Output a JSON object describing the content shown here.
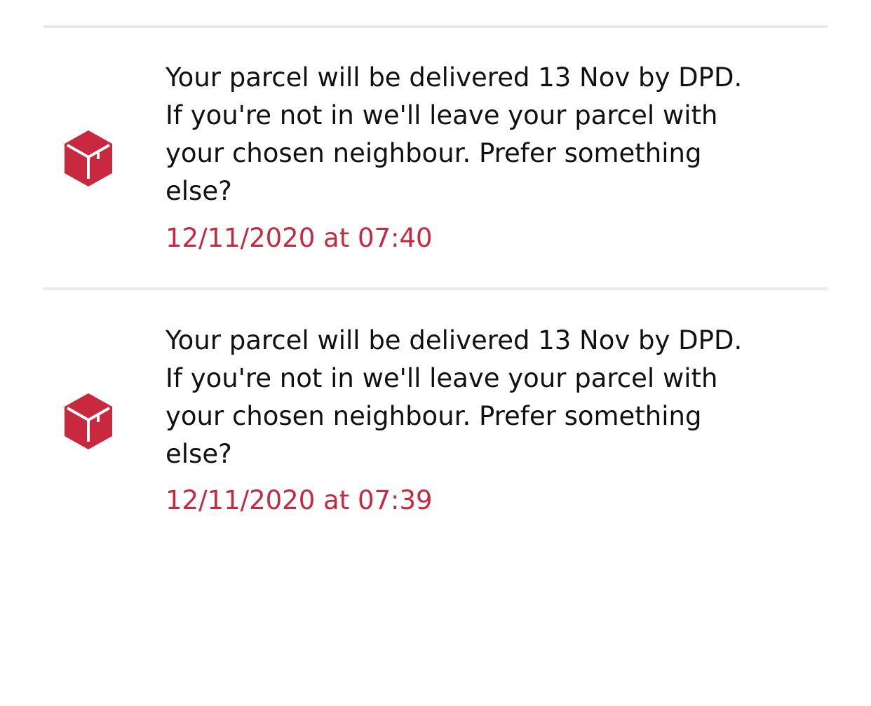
{
  "colors": {
    "accent": "#c8293f",
    "text": "#111111",
    "divider": "#e9e9e9",
    "background": "#ffffff"
  },
  "notifications": [
    {
      "icon": "parcel-box-icon",
      "message": "Your parcel will be delivered 13 Nov by DPD.\nIf you're not in we'll leave your parcel with\nyour chosen neighbour. Prefer something\nelse?",
      "timestamp": "12/11/2020 at 07:40"
    },
    {
      "icon": "parcel-box-icon",
      "message": "Your parcel will be delivered 13 Nov by DPD.\nIf you're not in we'll leave your parcel with\nyour chosen neighbour. Prefer something\nelse?",
      "timestamp": "12/11/2020 at 07:39"
    }
  ]
}
